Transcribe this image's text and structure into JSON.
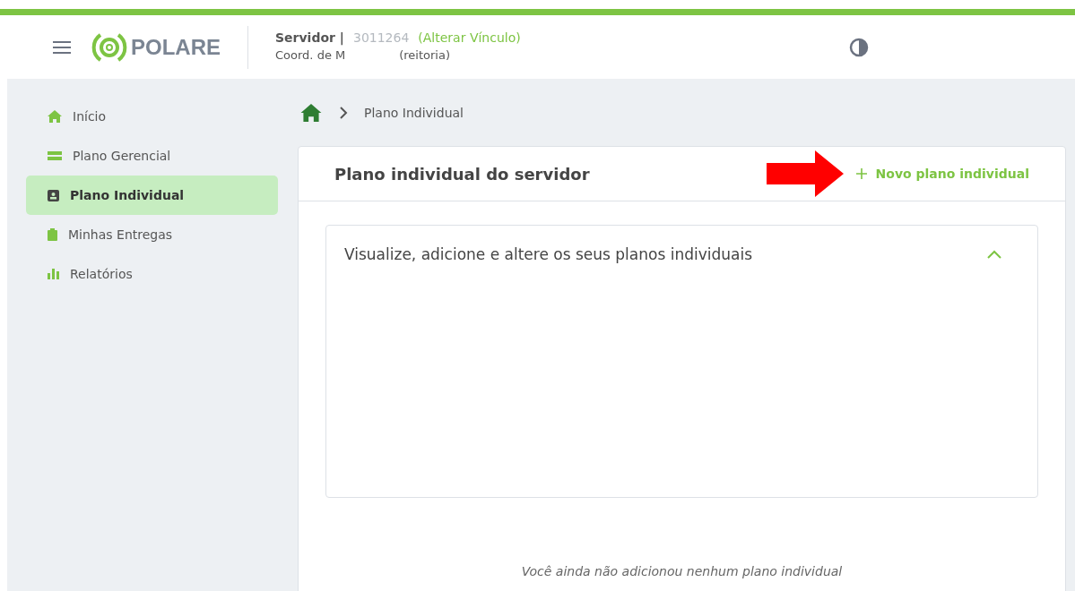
{
  "header": {
    "brand": "POLARE",
    "role": "Servidor |",
    "registration": "3011264",
    "change_link": "(Alterar Vínculo)",
    "unit_start": "Coord. de M",
    "unit_end": "(reitoria)"
  },
  "sidebar": {
    "items": [
      {
        "label": "Início",
        "kind": "home",
        "selected": false
      },
      {
        "label": "Plano Gerencial",
        "kind": "bars",
        "selected": false
      },
      {
        "label": "Plano Individual",
        "kind": "card",
        "selected": true
      },
      {
        "label": "Minhas Entregas",
        "kind": "clipboard",
        "selected": false
      },
      {
        "label": "Relatórios",
        "kind": "chart",
        "selected": false
      }
    ]
  },
  "breadcrumb": [
    "Plano Individual"
  ],
  "card": {
    "title": "Plano individual do servidor",
    "action": "Novo plano individual",
    "panel_title": "Visualize, adicione e altere os seus planos individuais",
    "panel_expanded": true,
    "empty_message": "Você ainda não adicionou nenhum plano individual"
  }
}
